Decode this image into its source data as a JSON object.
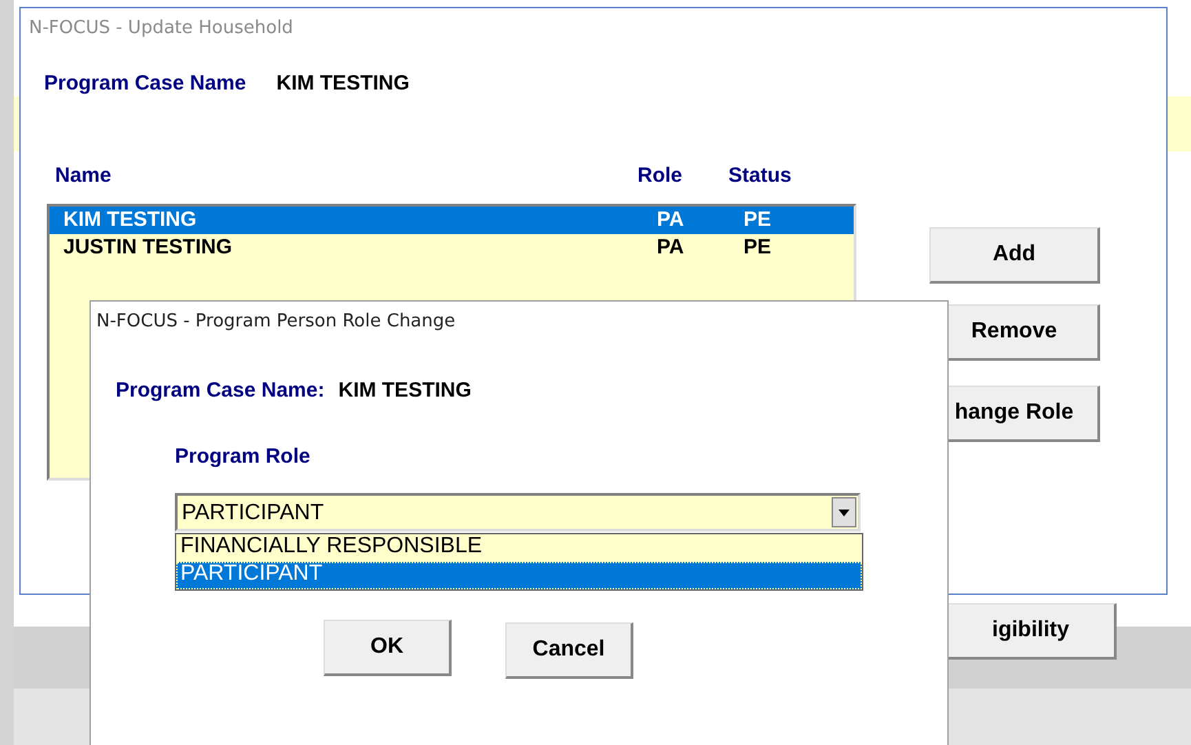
{
  "main_window": {
    "title": "N-FOCUS - Update Household",
    "case_name_label": "Program Case Name",
    "case_name": "KIM TESTING",
    "columns": [
      "Name",
      "Role",
      "Status"
    ],
    "rows": [
      {
        "name": "KIM TESTING",
        "role": "PA",
        "status": "PE",
        "selected": true
      },
      {
        "name": "JUSTIN TESTING",
        "role": "PA",
        "status": "PE",
        "selected": false
      }
    ],
    "buttons": [
      "Add",
      "Remove",
      "hange Role",
      "igibility"
    ]
  },
  "dialog": {
    "title": "N-FOCUS - Program Person Role Change",
    "case_name_label": "Program Case Name:",
    "case_name": "KIM TESTING",
    "role_label": "Program Role",
    "dropdown": {
      "value": "PARTICIPANT",
      "expanded": true,
      "options": [
        {
          "label": "FINANCIALLY RESPONSIBLE",
          "selected": false
        },
        {
          "label": "PARTICIPANT",
          "selected": true
        }
      ]
    },
    "buttons": [
      "OK",
      "Cancel"
    ]
  }
}
